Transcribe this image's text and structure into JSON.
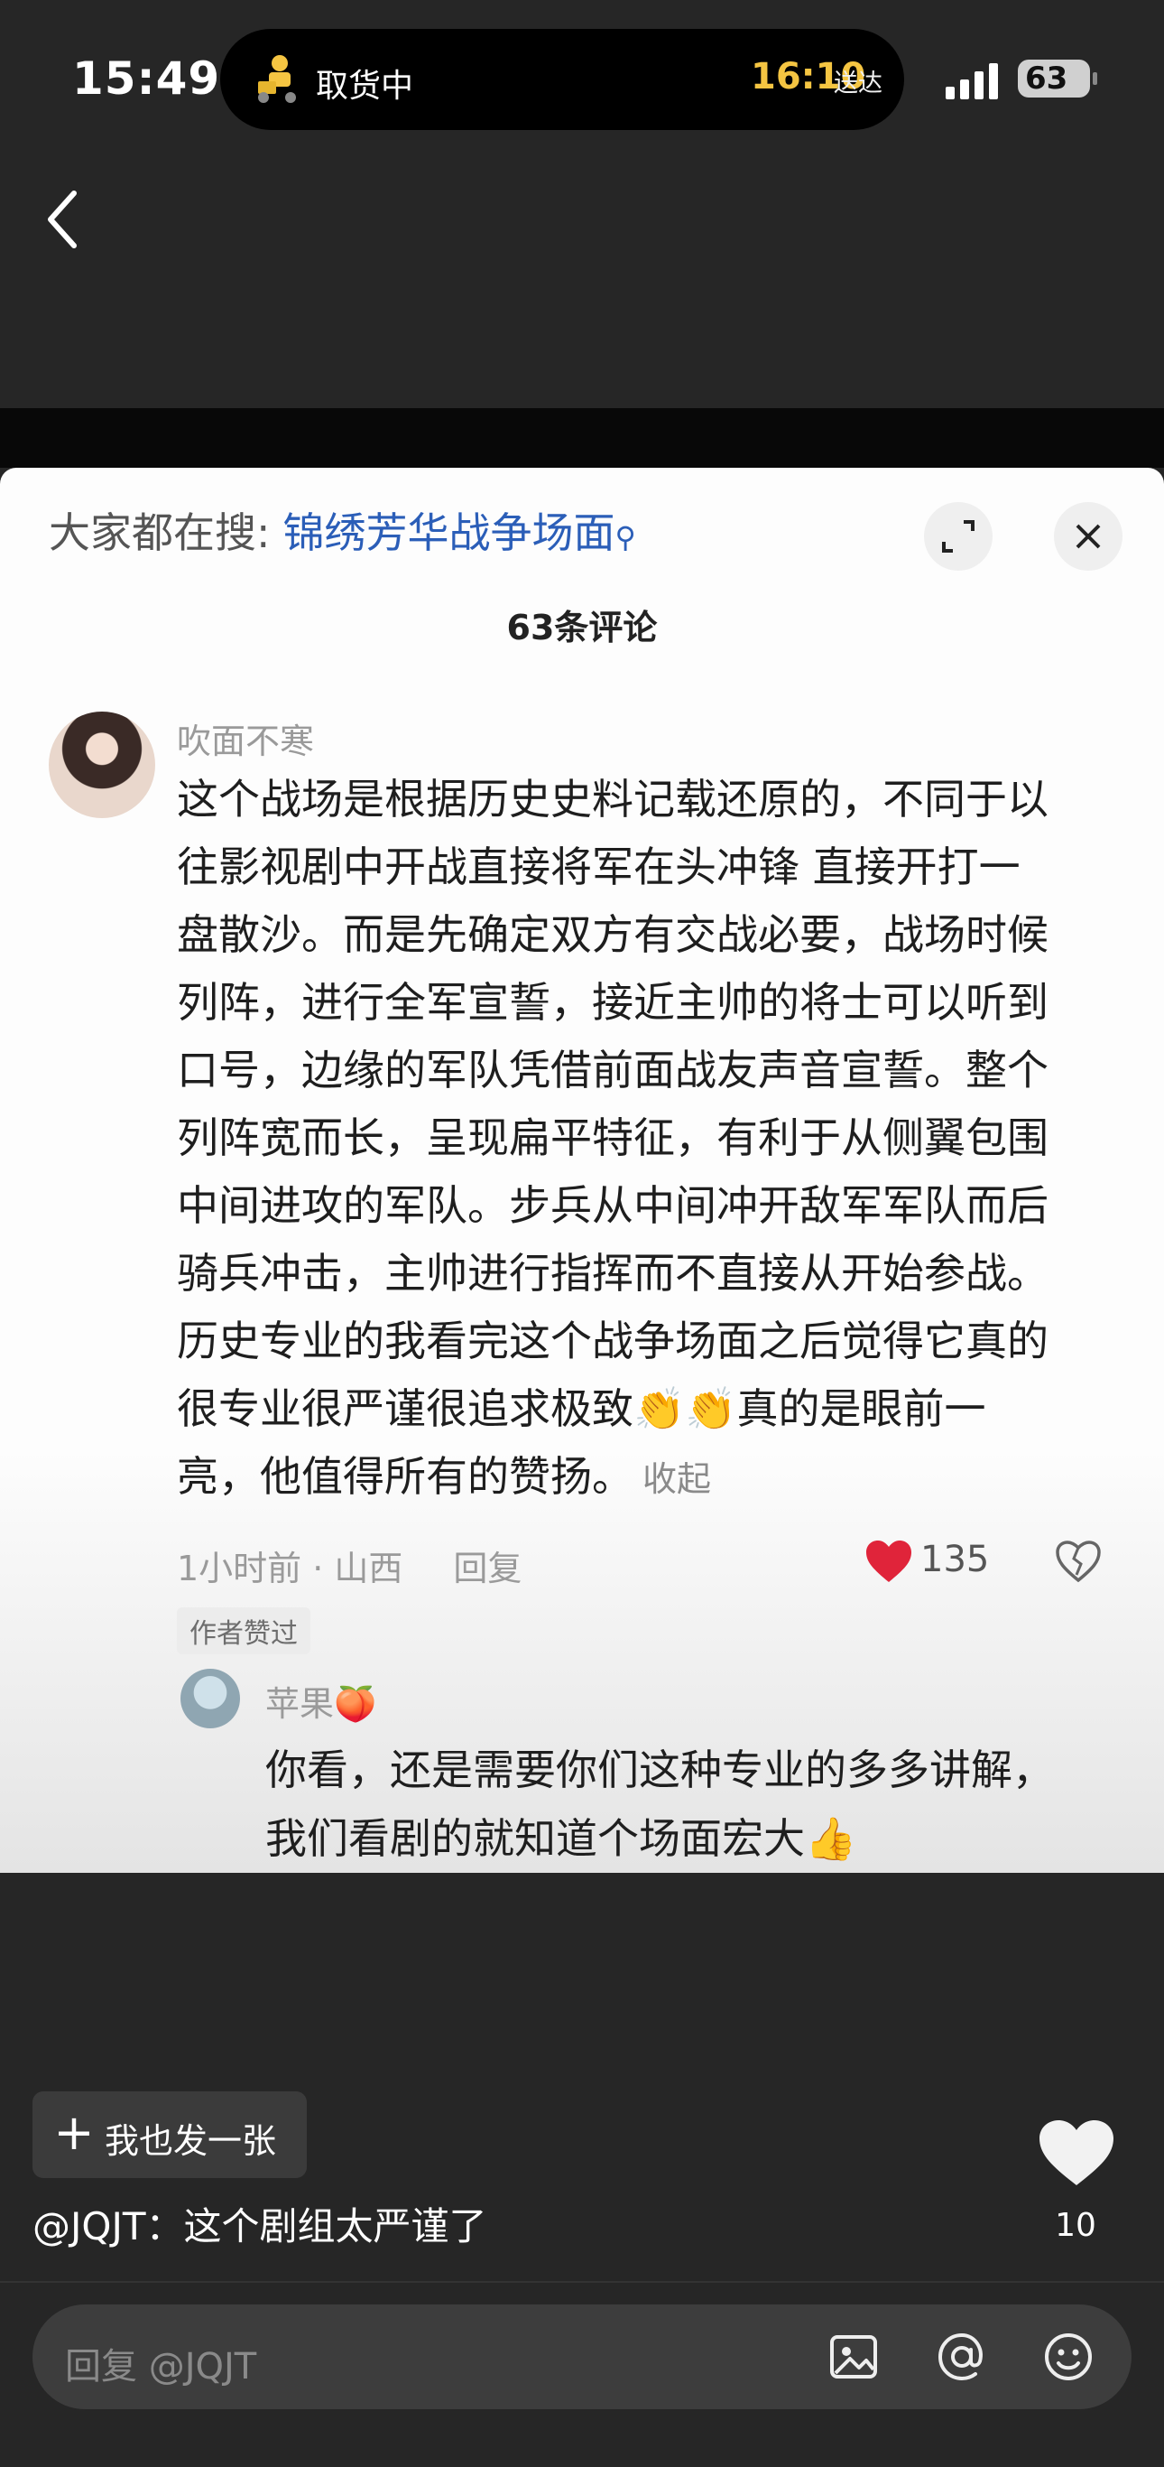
{
  "status_bar": {
    "time": "15:49",
    "island_label": "取货中",
    "island_time": "16:10",
    "island_sub": "送达",
    "battery": "63",
    "accent_color": "#f5c542"
  },
  "screenshot": {
    "search_prefix": "大家都在搜:",
    "search_term": "锦绣芳华战争场面",
    "comment_count": "63条评论",
    "comment": {
      "user": "吹面不寒",
      "lines": [
        "这个战场是根据历史史料记载还原的，不同于以",
        "往影视剧中开战直接将军在头冲锋 直接开打一",
        "盘散沙。而是先确定双方有交战必要，战场时候",
        "列阵，进行全军宣誓，接近主帅的将士可以听到",
        "口号，边缘的军队凭借前面战友声音宣誓。整个",
        "列阵宽而长，呈现扁平特征，有利于从侧翼包围",
        "中间进攻的军队。步兵从中间冲开敌军军队而后",
        "骑兵冲击，主帅进行指挥而不直接从开始参战。",
        "历史专业的我看完这个战争场面之后觉得它真的",
        "很专业很严谨很追求极致👏👏真的是眼前一",
        "亮，他值得所有的赞扬。"
      ],
      "collapse_label": "收起",
      "time_location": "1小时前 · 山西",
      "reply_label": "回复",
      "likes": "135",
      "author_tag": "作者赞过"
    },
    "reply": {
      "user": "苹果🍑",
      "lines": [
        "你看，还是需要你们这种专业的多多讲解，",
        "我们看剧的就知道个场面宏大👍"
      ]
    }
  },
  "post": {
    "post_button_label": "我也发一张",
    "caption": "@JQJT：这个剧组太严谨了",
    "likes": "10"
  },
  "reply_bar": {
    "placeholder": "回复 @JQJT",
    "icons": [
      "image-icon",
      "at-icon",
      "emoji-icon"
    ]
  }
}
